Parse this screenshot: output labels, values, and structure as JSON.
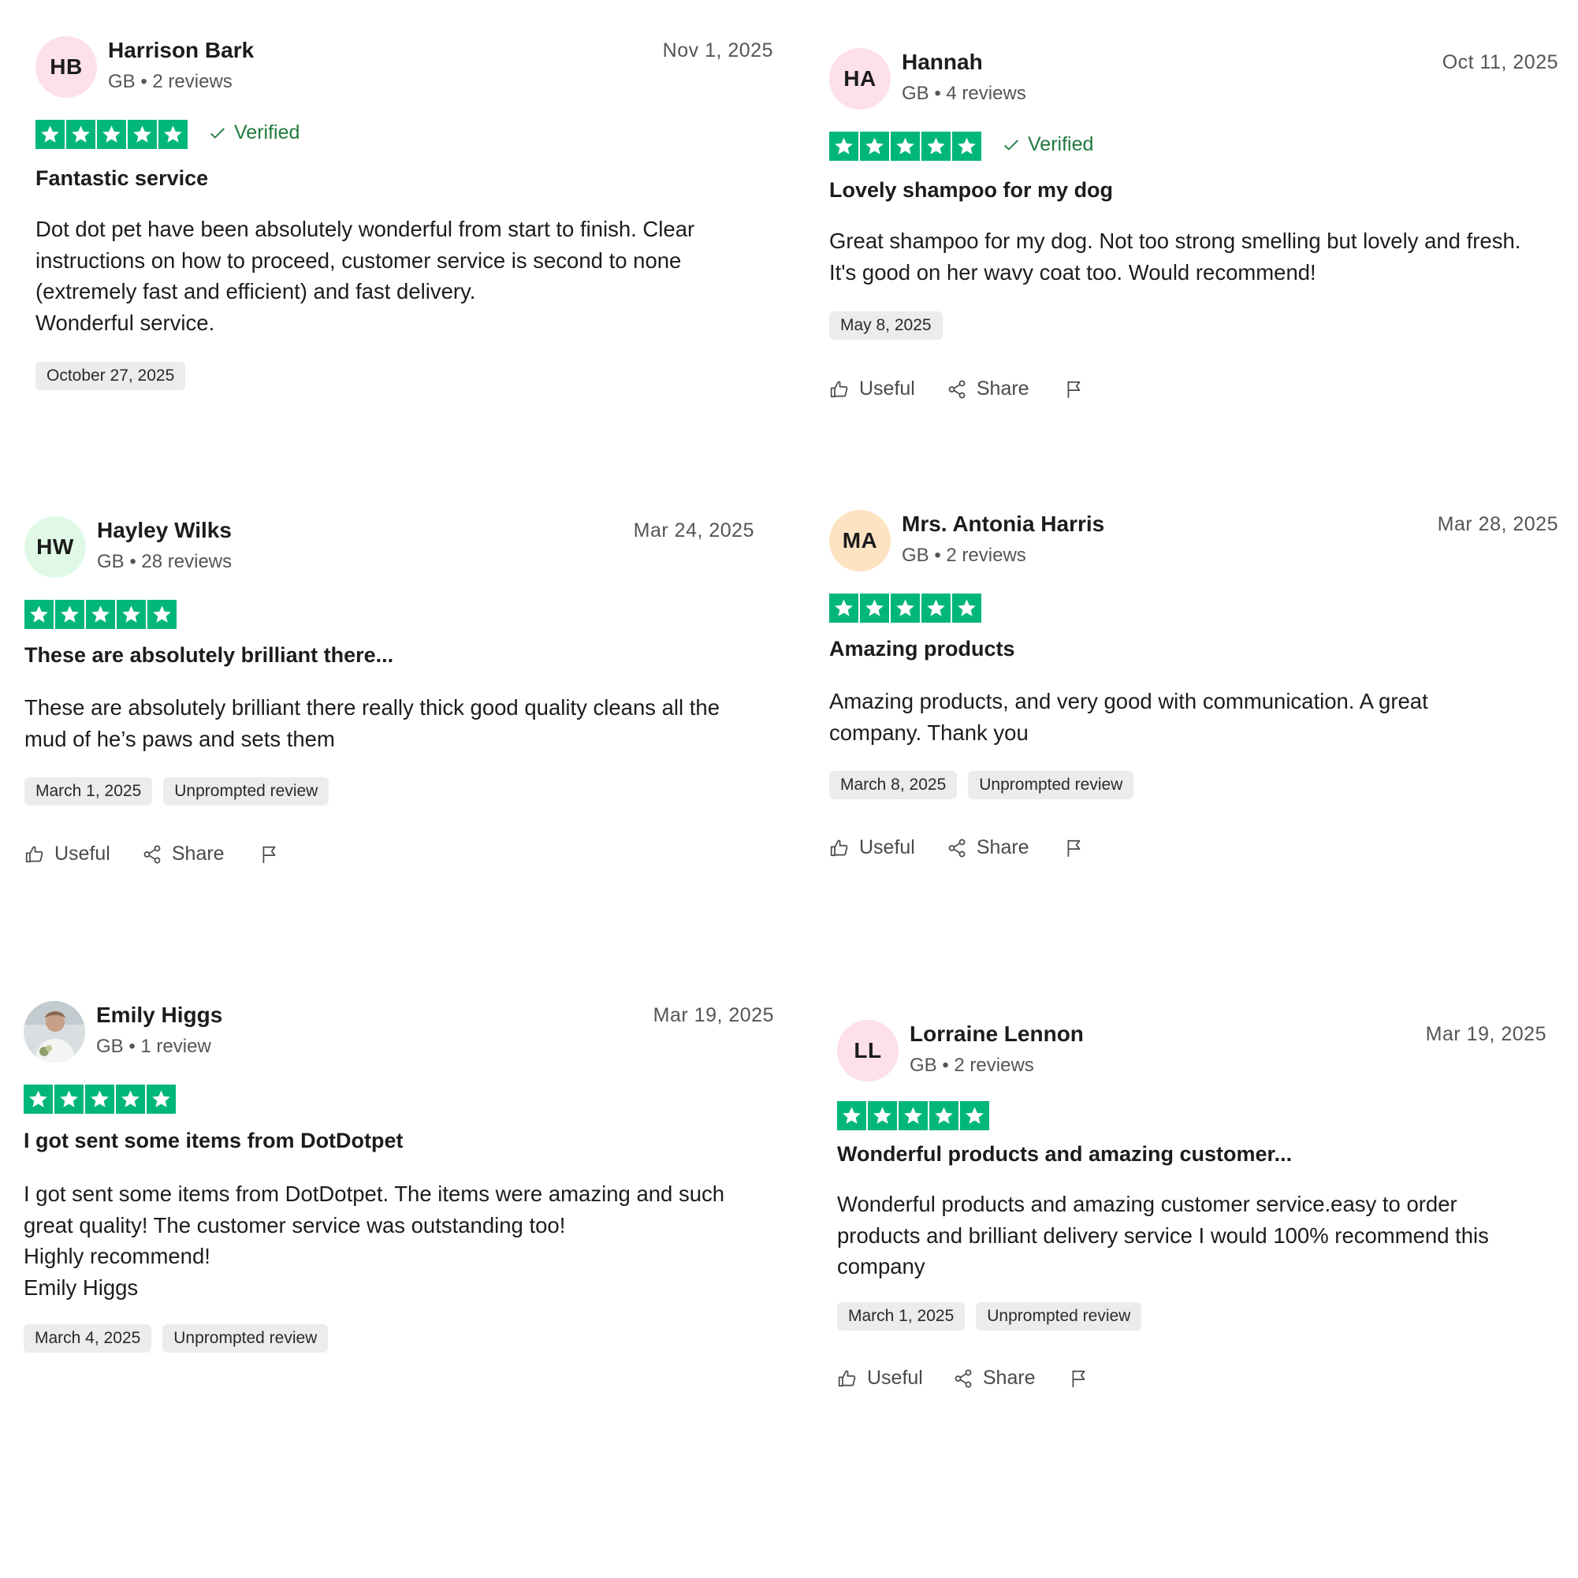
{
  "colors": {
    "star_green": "#00b67a",
    "verified_green": "#1f7a3e",
    "tag_bg": "#ececec"
  },
  "labels": {
    "verified": "Verified",
    "useful": "Useful",
    "share": "Share"
  },
  "reviews": [
    {
      "initials": "HB",
      "avatar_color": "#fde0ea",
      "name": "Harrison Bark",
      "meta": "GB • 2 reviews",
      "date": "Nov 1, 2025",
      "rating": 5,
      "verified": true,
      "title": "Fantastic service",
      "body": "Dot dot pet have been absolutely wonderful from start to finish. Clear instructions on how to proceed, customer service is second to none (extremely fast and efficient) and fast delivery.\nWonderful service.",
      "experience_date": "October 27, 2025"
    },
    {
      "initials": "HA",
      "avatar_color": "#fde0ea",
      "name": "Hannah",
      "meta": "GB • 4 reviews",
      "date": "Oct 11, 2025",
      "rating": 5,
      "verified": true,
      "title": "Lovely shampoo for my dog",
      "body": "Great shampoo for my dog. Not too strong smelling but lovely and fresh. It's good on her wavy coat too. Would recommend!",
      "experience_date": "May 8, 2025"
    },
    {
      "initials": "HW",
      "avatar_color": "#e0f9e6",
      "name": "Hayley Wilks",
      "meta": "GB • 28 reviews",
      "date": "Mar 24, 2025",
      "rating": 5,
      "verified": false,
      "title": "These are absolutely brilliant there...",
      "body": "These are absolutely brilliant there really thick good quality cleans all the mud of he’s paws and sets them",
      "experience_date": "March 1, 2025",
      "unprompted": "Unprompted review"
    },
    {
      "initials": "MA",
      "avatar_color": "#fde3c2",
      "name": "Mrs. Antonia Harris",
      "meta": "GB • 2 reviews",
      "date": "Mar 28, 2025",
      "rating": 5,
      "verified": false,
      "title": "Amazing products",
      "body": "Amazing products, and very good with communication. A great company. Thank you",
      "experience_date": "March 8, 2025",
      "unprompted": "Unprompted review"
    },
    {
      "initials": "",
      "avatar_color": "#dfe4e6",
      "name": "Emily Higgs",
      "meta": "GB • 1 review",
      "date": "Mar 19, 2025",
      "rating": 5,
      "verified": false,
      "title": "I got sent some items from DotDotpet",
      "body": "I got sent some items from DotDotpet. The items were amazing and such great quality! The customer service was outstanding too!\nHighly recommend!\nEmily Higgs",
      "experience_date": "March 4, 2025",
      "unprompted": "Unprompted review"
    },
    {
      "initials": "LL",
      "avatar_color": "#fde0ea",
      "name": "Lorraine Lennon",
      "meta": "GB • 2 reviews",
      "date": "Mar 19, 2025",
      "rating": 5,
      "verified": false,
      "title": "Wonderful products and amazing customer...",
      "body": "Wonderful products and amazing customer service.easy to order products and brilliant delivery service I would 100% recommend this company",
      "experience_date": "March 1, 2025",
      "unprompted": "Unprompted review"
    }
  ]
}
